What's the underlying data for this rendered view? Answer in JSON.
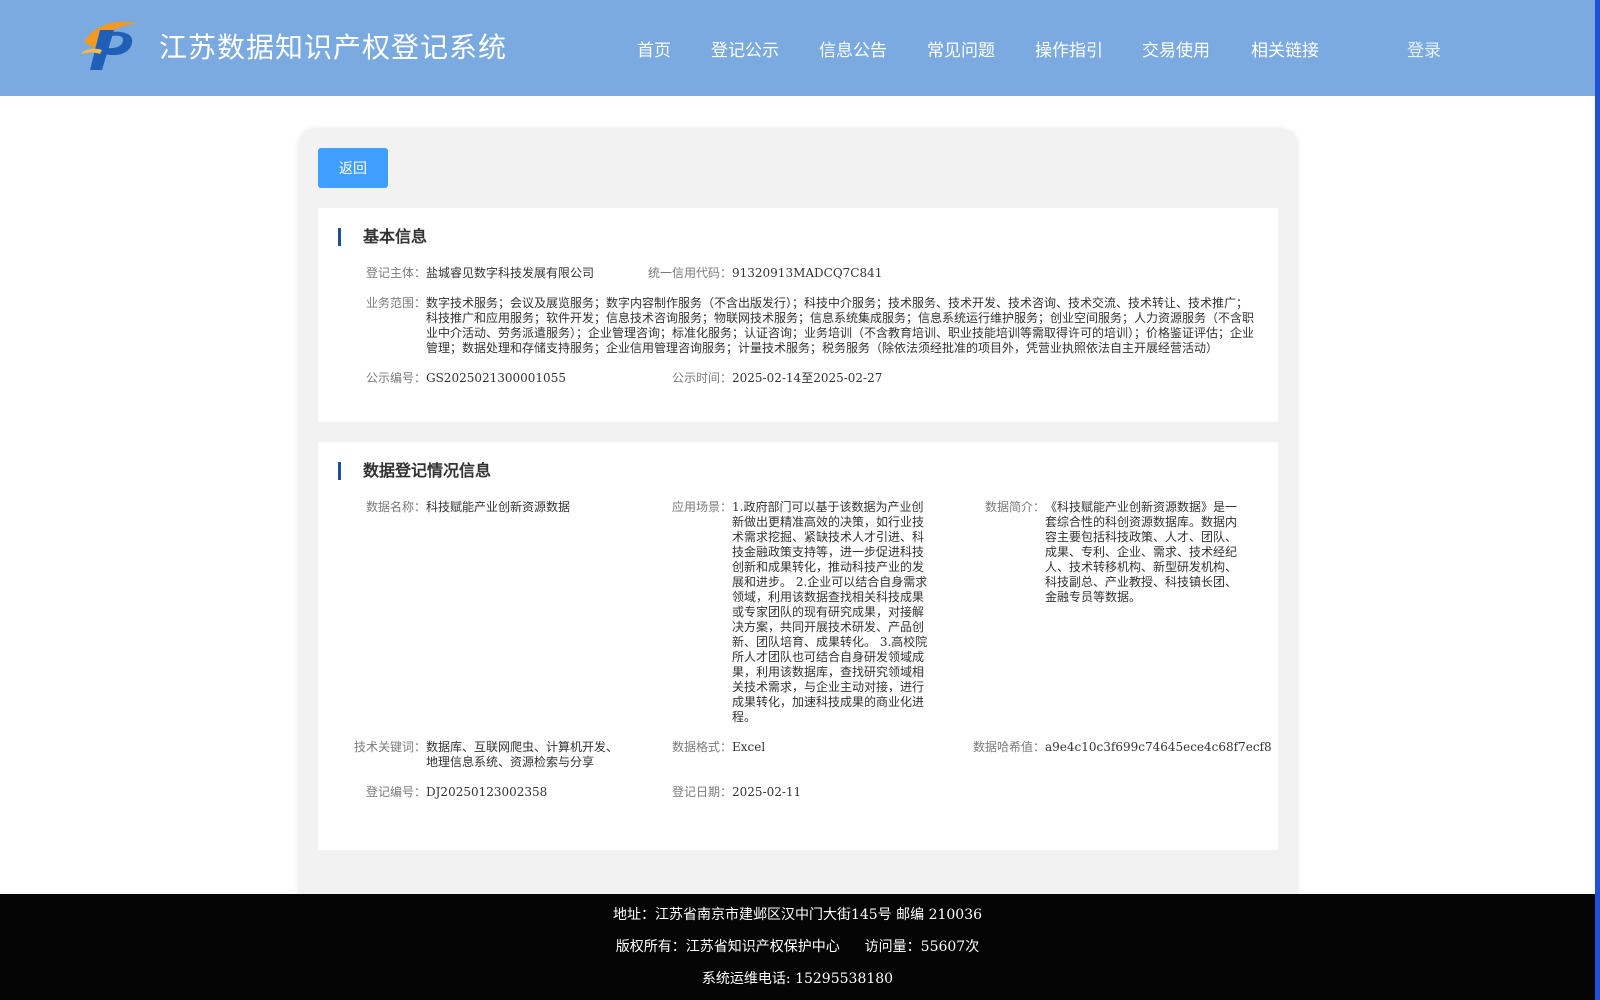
{
  "header": {
    "site_title": "江苏数据知识产权登记系统",
    "logo_icon": "ip-logo-icon",
    "nav": [
      "首页",
      "登记公示",
      "信息公告",
      "常见问题",
      "操作指引",
      "交易使用",
      "相关链接"
    ],
    "login_label": "登录",
    "colors": {
      "bar": "#7aaadf",
      "logo_orange": "#f29a1f",
      "logo_blue": "#1f5fb8"
    }
  },
  "actions": {
    "back_label": "返回",
    "back_color": "#409eff"
  },
  "basic_info": {
    "title": "基本信息",
    "subject_label": "登记主体：",
    "subject": "盐城睿见数字科技发展有限公司",
    "credit_code_label": "统一信用代码：",
    "credit_code": "91320913MADCQ7C841",
    "scope_label": "业务范围：",
    "scope": "数字技术服务；会议及展览服务；数字内容制作服务（不含出版发行）；科技中介服务；技术服务、技术开发、技术咨询、技术交流、技术转让、技术推广；科技推广和应用服务；软件开发；信息技术咨询服务；物联网技术服务；信息系统集成服务；信息系统运行维护服务；创业空间服务；人力资源服务（不含职业中介活动、劳务派遣服务）；企业管理咨询；标准化服务；认证咨询；业务培训（不含教育培训、职业技能培训等需取得许可的培训）；价格鉴证评估；企业管理；数据处理和存储支持服务；企业信用管理咨询服务；计量技术服务；税务服务（除依法须经批准的项目外，凭营业执照依法自主开展经营活动）",
    "notice_no_label": "公示编号：",
    "notice_no": "GS2025021300001055",
    "notice_time_label": "公示时间：",
    "notice_time": "2025-02-14至2025-02-27"
  },
  "data_info": {
    "title": "数据登记情况信息",
    "name_label": "数据名称：",
    "name": "科技赋能产业创新资源数据",
    "scenario_label": "应用场景：",
    "scenario": "1.政府部门可以基于该数据为产业创新做出更精准高效的决策，如行业技术需求挖掘、紧缺技术人才引进、科技金融政策支持等，进一步促进科技创新和成果转化，推动科技产业的发展和进步。 2.企业可以结合自身需求领域，利用该数据查找相关科技成果或专家团队的现有研究成果，对接解决方案，共同开展技术研发、产品创新、团队培育、成果转化。 3.高校院所人才团队也可结合自身研发领域成果，利用该数据库，查找研究领域相关技术需求，与企业主动对接，进行成果转化，加速科技成果的商业化进程。",
    "intro_label": "数据简介：",
    "intro": "《科技赋能产业创新资源数据》是一套综合性的科创资源数据库。数据内容主要包括科技政策、人才、团队、成果、专利、企业、需求、技术经纪人、技术转移机构、新型研发机构、科技副总、产业教授、科技镇长团、金融专员等数据。",
    "keywords_label": "技术关键词：",
    "keywords": "数据库、互联网爬虫、计算机开发、地理信息系统、资源检索与分享",
    "format_label": "数据格式：",
    "format": "Excel",
    "hash_label": "数据哈希值：",
    "hash": "a9e4c10c3f699c74645ece4c68f7ecf8",
    "reg_no_label": "登记编号：",
    "reg_no": "DJ20250123002358",
    "reg_date_label": "登记日期：",
    "reg_date": "2025-02-11"
  },
  "footer": {
    "address": "地址：江苏省南京市建邺区汉中门大街145号 邮编 210036",
    "copyright": "版权所有：江苏省知识产权保护中心",
    "visits_label": "访问量：",
    "visits": "55607次",
    "hotline": "系统运维电话: 15295538180"
  }
}
